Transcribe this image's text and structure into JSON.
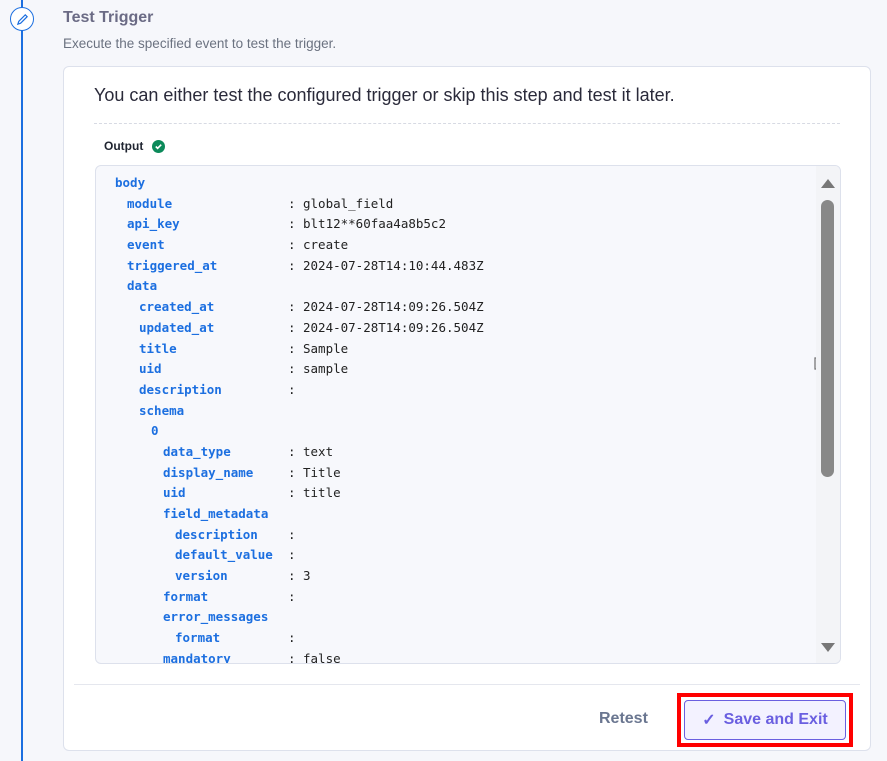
{
  "step": {
    "title": "Test Trigger",
    "subtitle": "Execute the specified event to test the trigger.",
    "icon": "pencil-icon"
  },
  "card": {
    "intro": "You can either test the configured trigger or skip this step and test it later.",
    "output_label": "Output",
    "output_status": "success"
  },
  "rows": [
    {
      "key": "body",
      "level": 0,
      "value": null
    },
    {
      "key": "module",
      "level": 1,
      "value": "global_field"
    },
    {
      "key": "api_key",
      "level": 1,
      "value": "blt12**60faa4a8b5c2"
    },
    {
      "key": "event",
      "level": 1,
      "value": "create"
    },
    {
      "key": "triggered_at",
      "level": 1,
      "value": "2024-07-28T14:10:44.483Z"
    },
    {
      "key": "data",
      "level": 1,
      "value": null
    },
    {
      "key": "created_at",
      "level": 2,
      "value": "2024-07-28T14:09:26.504Z"
    },
    {
      "key": "updated_at",
      "level": 2,
      "value": "2024-07-28T14:09:26.504Z"
    },
    {
      "key": "title",
      "level": 2,
      "value": "Sample"
    },
    {
      "key": "uid",
      "level": 2,
      "value": "sample"
    },
    {
      "key": "description",
      "level": 2,
      "value": ""
    },
    {
      "key": "schema",
      "level": 2,
      "value": null
    },
    {
      "key": "0",
      "level": 3,
      "value": null
    },
    {
      "key": "data_type",
      "level": 4,
      "value": "text"
    },
    {
      "key": "display_name",
      "level": 4,
      "value": "Title"
    },
    {
      "key": "uid",
      "level": 4,
      "value": "title"
    },
    {
      "key": "field_metadata",
      "level": 4,
      "value": null
    },
    {
      "key": "description",
      "level": 5,
      "value": ""
    },
    {
      "key": "default_value",
      "level": 5,
      "value": ""
    },
    {
      "key": "version",
      "level": 5,
      "value": "3"
    },
    {
      "key": "format",
      "level": 4,
      "value": ""
    },
    {
      "key": "error_messages",
      "level": 4,
      "value": null
    },
    {
      "key": "format",
      "level": 5,
      "value": ""
    },
    {
      "key": "mandatory",
      "level": 4,
      "value": "false"
    }
  ],
  "footer": {
    "retest": "Retest",
    "save": "Save and Exit",
    "save_icon": "checkmark-icon"
  }
}
